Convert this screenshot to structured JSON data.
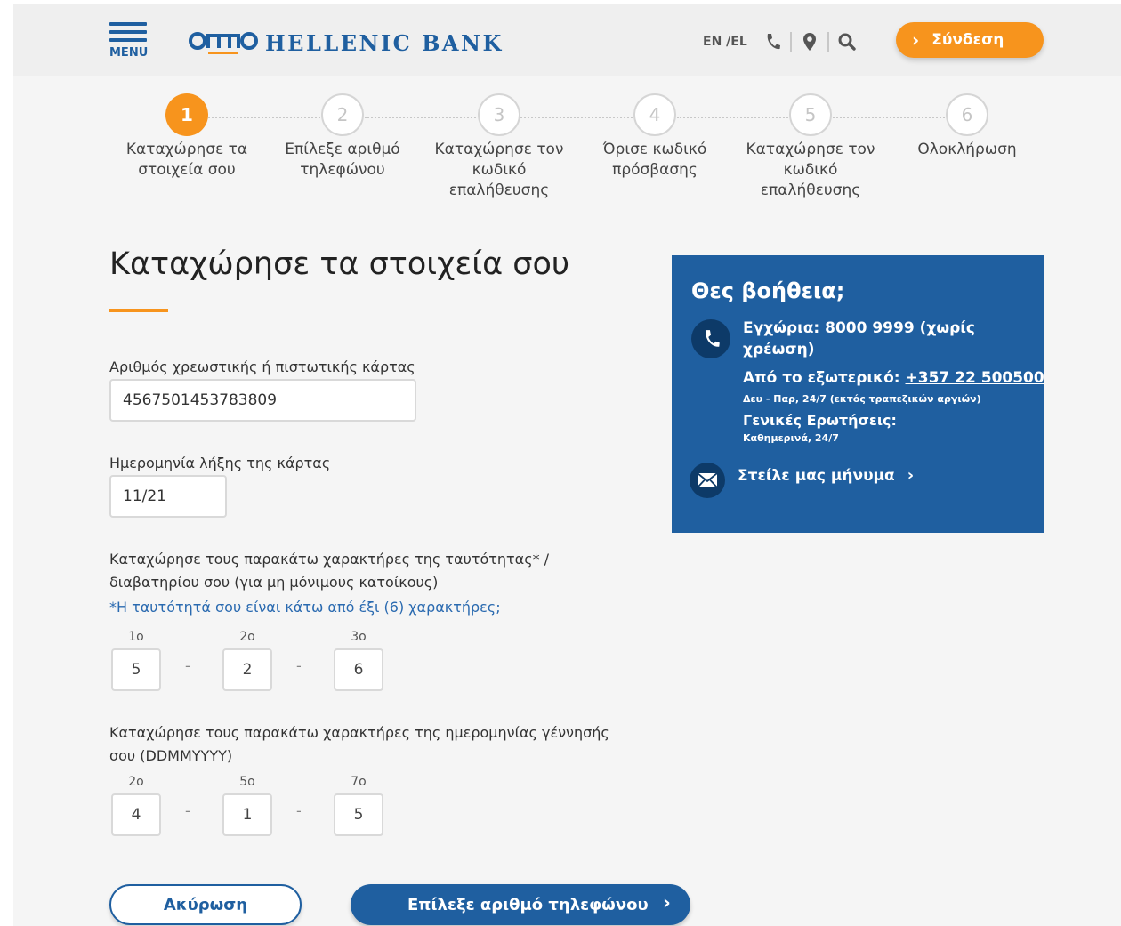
{
  "header": {
    "menu_label": "MENU",
    "logo_text": "HELLENIC BANK",
    "lang": "EN /EL",
    "login_label": "Σύνδεση",
    "icons": [
      "phone-icon",
      "location-pin-icon",
      "search-icon",
      "chevron-right-icon"
    ]
  },
  "steps": [
    {
      "num": "1",
      "label": "Καταχώρησε τα στοιχεία σου",
      "active": true
    },
    {
      "num": "2",
      "label": "Επίλεξε αριθμό τηλεφώνου",
      "active": false
    },
    {
      "num": "3",
      "label": "Καταχώρησε τον κωδικό επαλήθευσης",
      "active": false
    },
    {
      "num": "4",
      "label": "Όρισε κωδικό πρόσβασης",
      "active": false
    },
    {
      "num": "5",
      "label": "Καταχώρησε τον κωδικό επαλήθευσης",
      "active": false
    },
    {
      "num": "6",
      "label": "Ολοκλήρωση",
      "active": false
    }
  ],
  "form": {
    "title": "Καταχώρησε τα στοιχεία σου",
    "card_label": "Αριθμός χρεωστικής ή πιστωτικής κάρτας",
    "card_value": "4567501453783809",
    "expiry_label": "Ημερομηνία λήξης της κάρτας",
    "expiry_value": "11/21",
    "id_label_line1": "Καταχώρησε τους παρακάτω χαρακτήρες της ταυτότητας* /",
    "id_label_line2": "διαβατηρίου σου (για μη μόνιμους κατοίκους)",
    "id_help_link": "*Η ταυτότητά σου είναι κάτω από έξι (6) χαρακτήρες;",
    "id_chars": [
      {
        "label": "1ο",
        "value": "5"
      },
      {
        "label": "2ο",
        "value": "2"
      },
      {
        "label": "3ο",
        "value": "6"
      }
    ],
    "dob_label_line1": "Καταχώρησε τους παρακάτω χαρακτήρες της ημερομηνίας γέννησής",
    "dob_label_line2": "σου (DDMMYYYY)",
    "dob_chars": [
      {
        "label": "2ο",
        "value": "4"
      },
      {
        "label": "5ο",
        "value": "1"
      },
      {
        "label": "7ο",
        "value": "5"
      }
    ],
    "separator": "-",
    "cancel_label": "Ακύρωση",
    "next_label": "Επίλεξε αριθμό τηλεφώνου"
  },
  "help": {
    "title": "Θες βοήθεια;",
    "local_prefix": "Εγχώρια: ",
    "local_number": "8000 9999 ",
    "local_suffix": "(χωρίς χρέωση)",
    "abroad_prefix": "Από το εξωτερικό: ",
    "abroad_number": "+357 22 500500",
    "abroad_hours": "Δευ - Παρ, 24/7 (εκτός τραπεζικών αργιών)",
    "general_label": "Γενικές Ερωτήσεις:",
    "general_hours": "Καθημερινά, 24/7",
    "message_label": "Στείλε μας μήνυμα",
    "colors": {
      "panel": "#1f5fa0",
      "icon_circle": "#0d3a68"
    }
  },
  "colors": {
    "accent": "#f7941d",
    "brand": "#1f5fa0"
  }
}
